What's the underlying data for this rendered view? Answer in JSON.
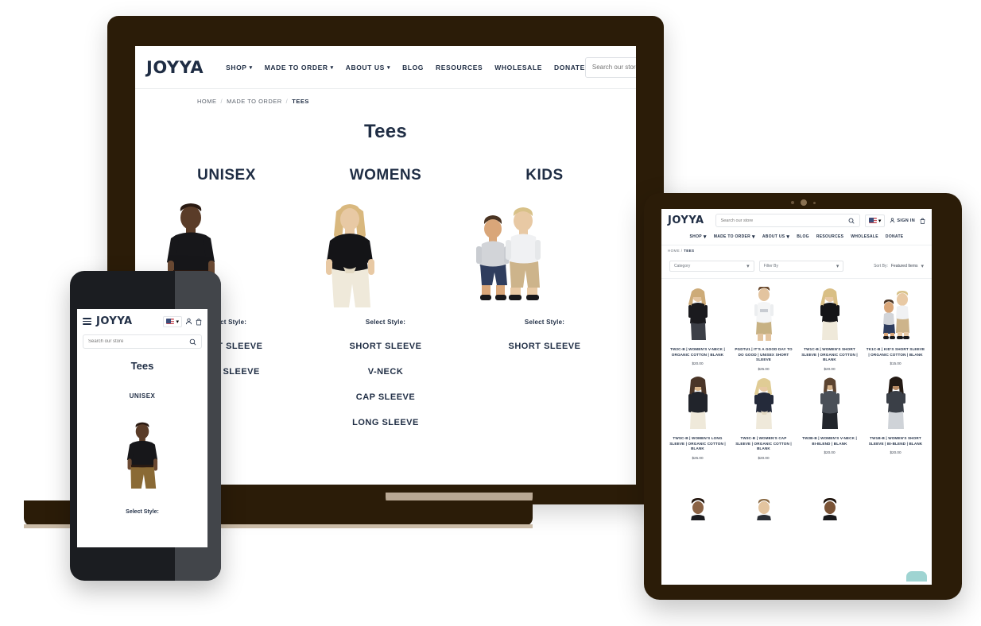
{
  "brand": {
    "name": "JOYYA"
  },
  "desktop": {
    "nav": [
      {
        "label": "SHOP",
        "caret": true
      },
      {
        "label": "MADE TO ORDER",
        "caret": true
      },
      {
        "label": "ABOUT US",
        "caret": true
      },
      {
        "label": "BLOG",
        "caret": false
      },
      {
        "label": "RESOURCES",
        "caret": false
      },
      {
        "label": "WHOLESALE",
        "caret": false
      },
      {
        "label": "DONATE",
        "caret": false
      }
    ],
    "search": {
      "placeholder": "Search our store",
      "value": ""
    },
    "breadcrumb": {
      "home": "HOME",
      "parent": "MADE TO ORDER",
      "current": "TEES",
      "sep": "/"
    },
    "page_title": "Tees",
    "categories": [
      {
        "title": "UNISEX",
        "select_label": "Select Style:",
        "styles": [
          "SHORT SLEEVE",
          "LONG SLEEVE"
        ]
      },
      {
        "title": "WOMENS",
        "select_label": "Select Style:",
        "styles": [
          "SHORT SLEEVE",
          "V-NECK",
          "CAP SLEEVE",
          "LONG SLEEVE"
        ]
      },
      {
        "title": "KIDS",
        "select_label": "Select Style:",
        "styles": [
          "SHORT SLEEVE"
        ]
      }
    ]
  },
  "tablet": {
    "search": {
      "placeholder": "Search our store",
      "value": ""
    },
    "sign_in": "SIGN IN",
    "nav": [
      {
        "label": "SHOP",
        "caret": true
      },
      {
        "label": "MADE TO ORDER",
        "caret": true
      },
      {
        "label": "ABOUT US",
        "caret": true
      },
      {
        "label": "BLOG",
        "caret": false
      },
      {
        "label": "RESOURCES",
        "caret": false
      },
      {
        "label": "WHOLESALE",
        "caret": false
      },
      {
        "label": "DONATE",
        "caret": false
      }
    ],
    "breadcrumb": {
      "home": "HOME",
      "sep": " / ",
      "current": "TEES"
    },
    "filters": {
      "category_label": "Category",
      "filter_by_label": "Filter By",
      "sort_by_label": "Sort By:",
      "sort_by_value": "Featured Items"
    },
    "products": [
      {
        "name": "TW2C-B | WOMEN'S V-NECK | ORGANIC COTTON | BLANK",
        "price": "$20.00",
        "model": "woman-black-tee"
      },
      {
        "name": "PGDTU1 | IT'S A GOOD DAY TO DO GOOD | UNISEX SHORT SLEEVE",
        "price": "$25.00",
        "model": "man-white-tee"
      },
      {
        "name": "TW1C-B | WOMEN'S SHORT SLEEVE | ORGANIC COTTON | BLANK",
        "price": "$20.00",
        "model": "woman-black-tee-cream"
      },
      {
        "name": "TK1C-B | KID'S SHORT SLEEVE | ORGANIC COTTON | BLANK",
        "price": "$15.00",
        "model": "two-kids"
      },
      {
        "name": "TWSC-B | WOMEN'S LONG SLEEVE | ORGANIC COTTON | BLANK",
        "price": "$25.00",
        "model": "woman-long-sleeve"
      },
      {
        "name": "TW3C-B | WOMEN'S CAP SLEEVE | ORGANIC COTTON | BLANK",
        "price": "$20.00",
        "model": "woman-cap-sleeve"
      },
      {
        "name": "TW2B-B | WOMEN'S V-NECK | BI-BLEND | BLANK",
        "price": "$20.00",
        "model": "woman-vneck-grey"
      },
      {
        "name": "TW1B-B | WOMEN'S SHORT SLEEVE | BI-BLEND | BLANK",
        "price": "$20.00",
        "model": "woman-short-sleeve-grey"
      }
    ]
  },
  "phone": {
    "search": {
      "placeholder": "Search our store",
      "value": ""
    },
    "page_title": "Tees",
    "category": "UNISEX",
    "select_label": "Select Style:"
  }
}
